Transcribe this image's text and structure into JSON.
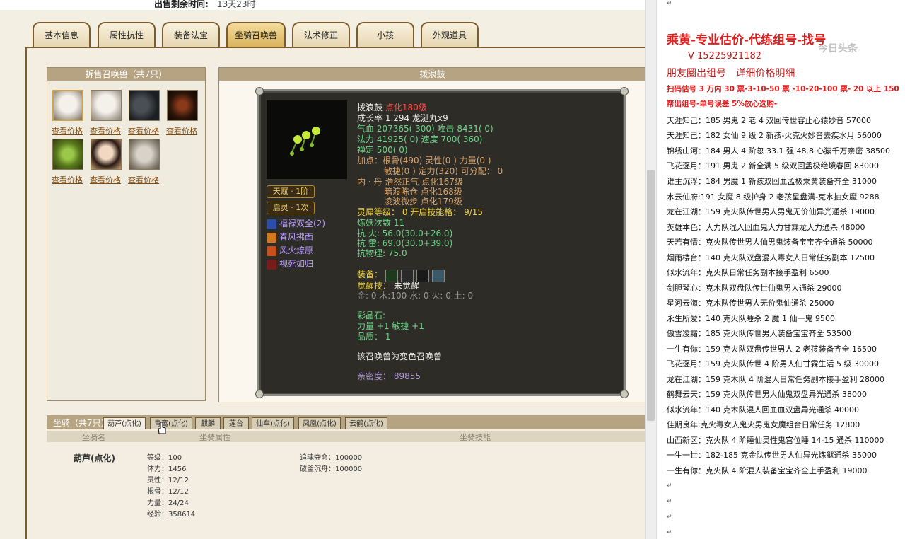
{
  "sale": {
    "label": "出售剩余时间:",
    "value": "13天23时"
  },
  "tabs": [
    {
      "label": "基本信息"
    },
    {
      "label": "属性抗性"
    },
    {
      "label": "装备法宝"
    },
    {
      "label": "坐骑召唤兽"
    },
    {
      "label": "法术修正"
    },
    {
      "label": "小孩"
    },
    {
      "label": "外观道具"
    }
  ],
  "pets_panel": {
    "title": "拆售召唤兽（共7只）",
    "link_label": "查看价格"
  },
  "detail": {
    "title": "拨浪鼓",
    "name": "拨浪鼓",
    "level": "点化180级",
    "growth": "成长率 1.294 龙涎丸x9",
    "hp_label": "气血 207365( 300)",
    "atk_label": "攻击 8431( 0)",
    "mp_label": "法力 41925( 0)",
    "spd_label": "速度 700( 360)",
    "zen": "禅定 500( 0)",
    "points_1": "加点：根骨(490) 灵性(0 ) 力量(0 )",
    "points_2": "敏捷(0 ) 定力(320) 可分配： 0",
    "dan_1": "内 · 丹  浩然正气 点化167级",
    "dan_2": "暗渡陈仓 点化168级",
    "dan_3": "凌波微步 点化179级",
    "spirit": "灵犀等级： 0 开启技能格： 9/15",
    "refine": "炼妖次数 11",
    "resist_fire": "抗  火: 56.0(30.0+26.0)",
    "resist_thunder": "抗  雷: 69.0(30.0+39.0)",
    "resist_phys": "抗物理: 75.0",
    "talent": "天赋 · 1阶",
    "qiling": "启灵 · 1次",
    "skills": [
      "福禄双全(2)",
      "春风拂面",
      "风火燎原",
      "视死如归"
    ],
    "equip_label": "装备：",
    "awaken_label": "觉醒技：",
    "awaken_value": "未觉醒",
    "elements": "金: 0 木:100 水: 0 火: 0 土: 0",
    "crystal": "彩晶石:",
    "crystal_stats": "力量 +1 敏捷 +1",
    "quality": "品质： 1",
    "color_note": "该召唤兽为变色召唤兽",
    "intimacy": "亲密度： 89855"
  },
  "mounts": {
    "title": "坐骑（共7只）",
    "tabs": [
      {
        "label": "葫芦(点化)"
      },
      {
        "label": "青鸾(点化)"
      },
      {
        "label": "麒麟"
      },
      {
        "label": "莲台"
      },
      {
        "label": "仙车(点化)"
      },
      {
        "label": "凤凰(点化)"
      },
      {
        "label": "云鹤(点化)"
      }
    ],
    "col_name": "坐骑名",
    "col_attr": "坐骑属性",
    "col_skill": "坐骑技能",
    "name": "葫芦(点化)",
    "stats": [
      "等级：100",
      "体力：1456",
      "灵性：12/12",
      "根骨：12/12",
      "力量：24/24",
      "经验：358614"
    ],
    "skills": [
      "追魂夺命：100000",
      "破釜沉舟：100000"
    ]
  },
  "doc": {
    "title": "乘黄-专业估价-代练组号-找号",
    "phone": "V 15225921182",
    "subtitle_1": "朋友圈出组号",
    "subtitle_2": "详细价格明细",
    "promo_1": "扫码估号 3 万内 30 票-3-10-50 票 -10-20-100 票- 20 以上 150",
    "promo_2": "帮出组号-单号误差 5%放心选购-",
    "lines": [
      "天涯知己：185 男鬼 2 老 4 双回传世容止心猿妙音 57000",
      "天涯知己：182 女仙 9 级 2 新孩-火克火妙音去疾水月 56000",
      "锦绣山河：184 男人 4 阶忽 33.1 强 48.8 心猿千万亲密 38500",
      "飞花逐月：191 男鬼 2 新全满 5 级双回孟极绝境春回 83000",
      "谁主沉浮：184 男魔 1 新孩双回血孟极乘黄装备齐全 31000",
      "水云仙府:191 女魔 8 级护身 2 老孩星盘满-克水抽女魔 9288",
      "龙在江湖：159 克火队传世男人男鬼无价仙异光通杀 19000",
      "英雄本色：大力队混人回血鬼大力甘霖龙大力通杀 48000",
      "天若有情：克火队传世男人仙男鬼装备宝宝齐全通杀 50000",
      "烟雨楼台：140 克火队双盘混人毒女人日常任务副本 12500",
      "似水流年：克火队日常任务副本接手盈利 6500",
      "剑胆琴心：克木队双盘队传世仙鬼男人通杀 29000",
      "星河云海：克木队传世男人无价鬼仙通杀 25000",
      "永生所爱：140 克火队睡杀 2 魔 1 仙一鬼 9500",
      "傲雪凌霜：185 克火队传世男人装备宝宝齐全 53500",
      "一生有你：159 克火队双盘传世男人 2 老孩装备齐全 16500",
      "飞花逐月：159 克火队传世 4 阶男人仙甘霖生活 5 级 30000",
      "龙在江湖：159 克木队 4 阶混人日常任务副本接手盈利 28000",
      "鹤舞云天：159 克火队传世男人仙鬼双盘异光通杀 38000",
      "似水流年：140 克木队混人回血血双盘异光通杀 40000",
      "佳期良年:克火毒女人鬼火男鬼女魔组合日常任务 12800",
      "山西新区：克火队 4 阶睡仙灵性鬼宫位睡 14-15 通杀 110000",
      "一生一世：182-185 克金队传世男人仙异光炼狱通杀 35000",
      "一生有你：克火队 4 阶混人装备宝宝齐全上手盈利 19000"
    ],
    "watermark": "今日头条"
  }
}
